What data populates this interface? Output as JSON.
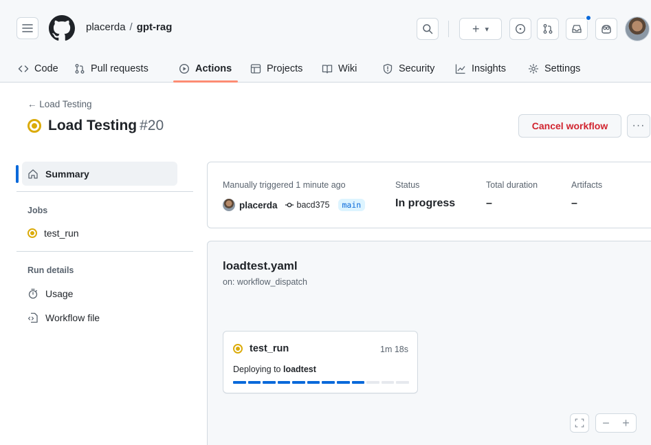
{
  "header": {
    "owner": "placerda",
    "separator": "/",
    "repo": "gpt-rag",
    "plus_label": "+",
    "caret": "▾"
  },
  "tabs": [
    {
      "label": "Code",
      "icon": "code-icon",
      "active": false
    },
    {
      "label": "Pull requests",
      "icon": "pull-request-icon",
      "active": false
    },
    {
      "label": "Actions",
      "icon": "play-icon",
      "active": true
    },
    {
      "label": "Projects",
      "icon": "table-icon",
      "active": false
    },
    {
      "label": "Wiki",
      "icon": "book-icon",
      "active": false
    },
    {
      "label": "Security",
      "icon": "shield-icon",
      "active": false
    },
    {
      "label": "Insights",
      "icon": "graph-icon",
      "active": false
    },
    {
      "label": "Settings",
      "icon": "gear-icon",
      "active": false
    }
  ],
  "run": {
    "back_label": "← Load Testing",
    "title": "Load Testing",
    "number": "#20",
    "cancel_label": "Cancel workflow",
    "more_label": "···"
  },
  "sidebar": {
    "summary_label": "Summary",
    "jobs_heading": "Jobs",
    "jobs": [
      {
        "label": "test_run",
        "status": "in_progress"
      }
    ],
    "run_details_heading": "Run details",
    "usage_label": "Usage",
    "workflow_file_label": "Workflow file"
  },
  "summary": {
    "trigger_label": "Manually triggered 1 minute ago",
    "actor": "placerda",
    "commit": "bacd375",
    "branch": "main",
    "status_label": "Status",
    "status_value": "In progress",
    "duration_label": "Total duration",
    "duration_value": "–",
    "artifacts_label": "Artifacts",
    "artifacts_value": "–"
  },
  "workflow": {
    "file": "loadtest.yaml",
    "trigger": "on: workflow_dispatch",
    "job": {
      "name": "test_run",
      "duration": "1m 18s",
      "step_prefix": "Deploying to ",
      "step_target": "loadtest",
      "progress_segments_total": 12,
      "progress_segments_done": 9
    }
  },
  "zoom": {
    "minus": "−",
    "plus": "+"
  },
  "colors": {
    "accent": "#0969da",
    "in_progress": "#dbab0a",
    "danger": "#d1242f",
    "tab_underline": "#fd8c73"
  }
}
